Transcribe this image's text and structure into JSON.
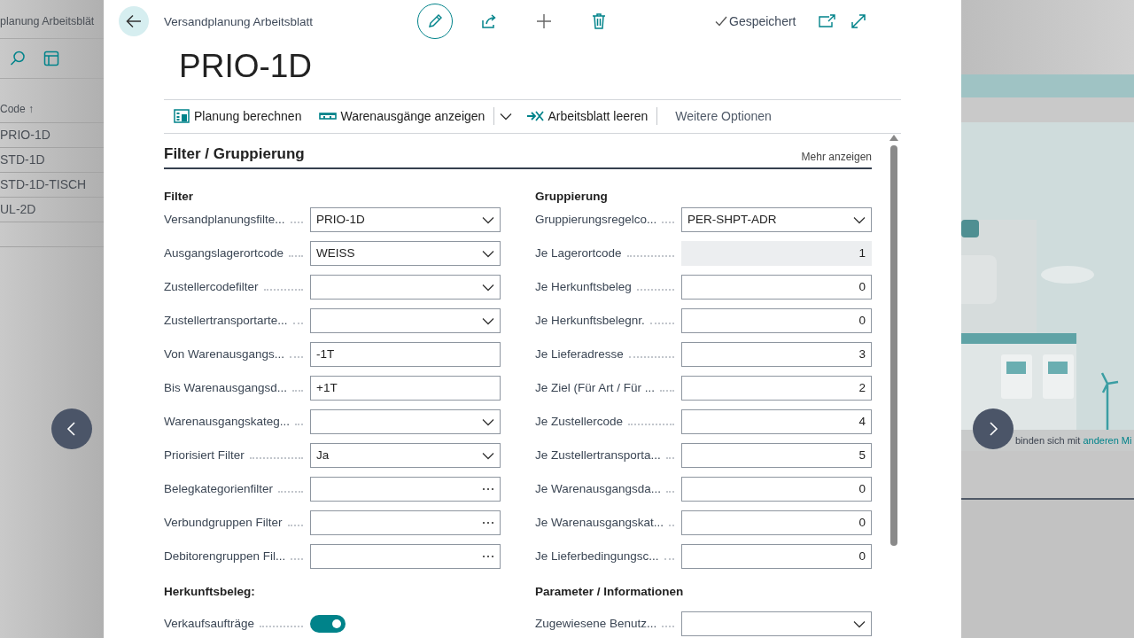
{
  "background_page": {
    "title": "planung Arbeitsblät",
    "column_header": "Code ↑",
    "rows": [
      "PRIO-1D",
      "STD-1D",
      "STD-1D-TISCH",
      "UL-2D"
    ],
    "banner_text": "binden sich mit",
    "banner_link": "anderen Mi"
  },
  "dialog": {
    "breadcrumb": "Versandplanung Arbeitsblatt",
    "status": "Gespeichert",
    "title": "PRIO-1D",
    "actions": [
      {
        "label": "Planung berechnen",
        "kind": "calc"
      },
      {
        "label": "Warenausgänge anzeigen",
        "kind": "shipment",
        "has_menu": true
      },
      {
        "label": "Arbeitsblatt leeren",
        "kind": "clear"
      },
      {
        "label": "Weitere Optionen",
        "kind": "more"
      }
    ]
  },
  "section": {
    "title": "Filter / Gruppierung",
    "more_link": "Mehr anzeigen",
    "columns": [
      {
        "groups": [
          {
            "heading": "Filter",
            "fields": [
              {
                "label": "Versandplanungsfilte...",
                "kind": "dropdown",
                "value": "PRIO-1D"
              },
              {
                "label": "Ausgangslagerortcode",
                "kind": "dropdown",
                "value": "WEISS"
              },
              {
                "label": "Zustellercodefilter",
                "kind": "dropdown"
              },
              {
                "label": "Zustellertransportarte...",
                "kind": "dropdown"
              },
              {
                "label": "Von Warenausgangs...",
                "kind": "text",
                "value": "-1T"
              },
              {
                "label": "Bis Warenausgangsd...",
                "kind": "text",
                "value": "+1T"
              },
              {
                "label": "Warenausgangskateg...",
                "kind": "dropdown"
              },
              {
                "label": "Priorisiert Filter",
                "kind": "dropdown",
                "value": "Ja"
              },
              {
                "label": "Belegkategorienfilter",
                "kind": "lookup"
              },
              {
                "label": "Verbundgruppen Filter",
                "kind": "lookup"
              },
              {
                "label": "Debitorengruppen Fil...",
                "kind": "lookup"
              }
            ]
          },
          {
            "heading": "Herkunftsbeleg:",
            "fields": [
              {
                "label": "Verkaufsaufträge",
                "kind": "toggle",
                "on": true
              }
            ]
          }
        ]
      },
      {
        "groups": [
          {
            "heading": "Gruppierung",
            "fields": [
              {
                "label": "Gruppierungsregelco...",
                "kind": "dropdown",
                "value": "PER-SHPT-ADR"
              },
              {
                "label": "Je Lagerortcode",
                "kind": "readonly",
                "value": "1"
              },
              {
                "label": "Je Herkunftsbeleg",
                "kind": "number",
                "value": "0"
              },
              {
                "label": "Je Herkunftsbelegnr.",
                "kind": "number",
                "value": "0"
              },
              {
                "label": "Je Lieferadresse",
                "kind": "number",
                "value": "3"
              },
              {
                "label": "Je Ziel (Für Art / Für ...",
                "kind": "number",
                "value": "2"
              },
              {
                "label": "Je Zustellercode",
                "kind": "number",
                "value": "4"
              },
              {
                "label": "Je Zustellertransporta...",
                "kind": "number",
                "value": "5"
              },
              {
                "label": "Je Warenausgangsda...",
                "kind": "number",
                "value": "0"
              },
              {
                "label": "Je Warenausgangskat...",
                "kind": "number",
                "value": "0"
              },
              {
                "label": "Je Lieferbedingungsc...",
                "kind": "number",
                "value": "0"
              }
            ]
          },
          {
            "heading": "Parameter / Informationen",
            "fields": [
              {
                "label": "Zugewiesene Benutz...",
                "kind": "dropdown"
              }
            ]
          }
        ]
      }
    ]
  }
}
